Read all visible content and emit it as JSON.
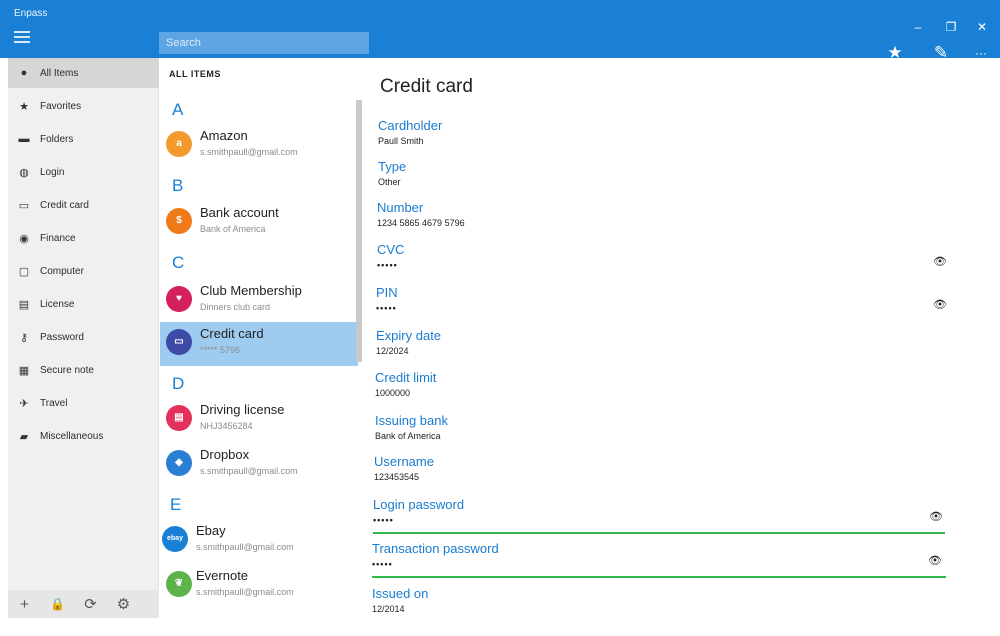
{
  "app": {
    "title": "Enpass"
  },
  "window_controls": {
    "minimize": "–",
    "restore": "❐",
    "close": "✕"
  },
  "search": {
    "placeholder": "Search"
  },
  "toolbar": {
    "favorite_icon": "★",
    "edit_icon": "✎",
    "more_icon": "···"
  },
  "sidebar": {
    "items": [
      {
        "label": "All Items",
        "icon": "●"
      },
      {
        "label": "Favorites",
        "icon": "★"
      },
      {
        "label": "Folders",
        "icon": "▬"
      },
      {
        "label": "Login",
        "icon": "◍"
      },
      {
        "label": "Credit card",
        "icon": "▭"
      },
      {
        "label": "Finance",
        "icon": "◉"
      },
      {
        "label": "Computer",
        "icon": "▢"
      },
      {
        "label": "License",
        "icon": "▤"
      },
      {
        "label": "Password",
        "icon": "⚷"
      },
      {
        "label": "Secure note",
        "icon": "▦"
      },
      {
        "label": "Travel",
        "icon": "✈"
      },
      {
        "label": "Miscellaneous",
        "icon": "▰"
      }
    ],
    "bottom": {
      "add": "+",
      "lock": "🔒",
      "sync": "⟳",
      "settings": "⚙"
    }
  },
  "list": {
    "header": "ALL ITEMS",
    "letters": {
      "a": "A",
      "b": "B",
      "c": "C",
      "d": "D",
      "e": "E"
    },
    "entries": [
      {
        "title": "Amazon",
        "subtitle": "s.smithpaull@gmail.com",
        "badge": "a",
        "color": "#f29a2e"
      },
      {
        "title": "Bank account",
        "subtitle": "Bank of America",
        "badge": "$",
        "color": "#f07a1a"
      },
      {
        "title": "Club Membership",
        "subtitle": "Dinners club card",
        "badge": "♥",
        "color": "#d3215c"
      },
      {
        "title": "Credit card",
        "subtitle": "***** 5796",
        "badge": "▭",
        "color": "#3e4ba6"
      },
      {
        "title": "Driving license",
        "subtitle": "NHJ3456284",
        "badge": "▤",
        "color": "#e2315a"
      },
      {
        "title": "Dropbox",
        "subtitle": "s.smithpaull@gmail.com",
        "badge": "◆",
        "color": "#2a7fd4"
      },
      {
        "title": "Ebay",
        "subtitle": "s.smithpaull@gmail.com",
        "badge": "ebay",
        "color": "#1a80d6"
      },
      {
        "title": "Evernote",
        "subtitle": "s.smithpaull@gmail.com",
        "badge": "❦",
        "color": "#5cb34a"
      }
    ]
  },
  "detail": {
    "title": "Credit card",
    "eye_icon": "👁",
    "fields": [
      {
        "label": "Cardholder",
        "value": "Paull Smith"
      },
      {
        "label": "Type",
        "value": "Other"
      },
      {
        "label": "Number",
        "value": "1234 5865 4679 5796"
      },
      {
        "label": "CVC",
        "value": "•••••"
      },
      {
        "label": "PIN",
        "value": "•••••"
      },
      {
        "label": "Expiry date",
        "value": "12/2024"
      },
      {
        "label": "Credit limit",
        "value": "1000000"
      },
      {
        "label": "Issuing bank",
        "value": "Bank of America"
      },
      {
        "label": "Username",
        "value": "123453545"
      },
      {
        "label": "Login password",
        "value": "•••••"
      },
      {
        "label": "Transaction password",
        "value": "•••••"
      },
      {
        "label": "Issued on",
        "value": "12/2014"
      }
    ],
    "strength_color": "#2eb84a"
  }
}
